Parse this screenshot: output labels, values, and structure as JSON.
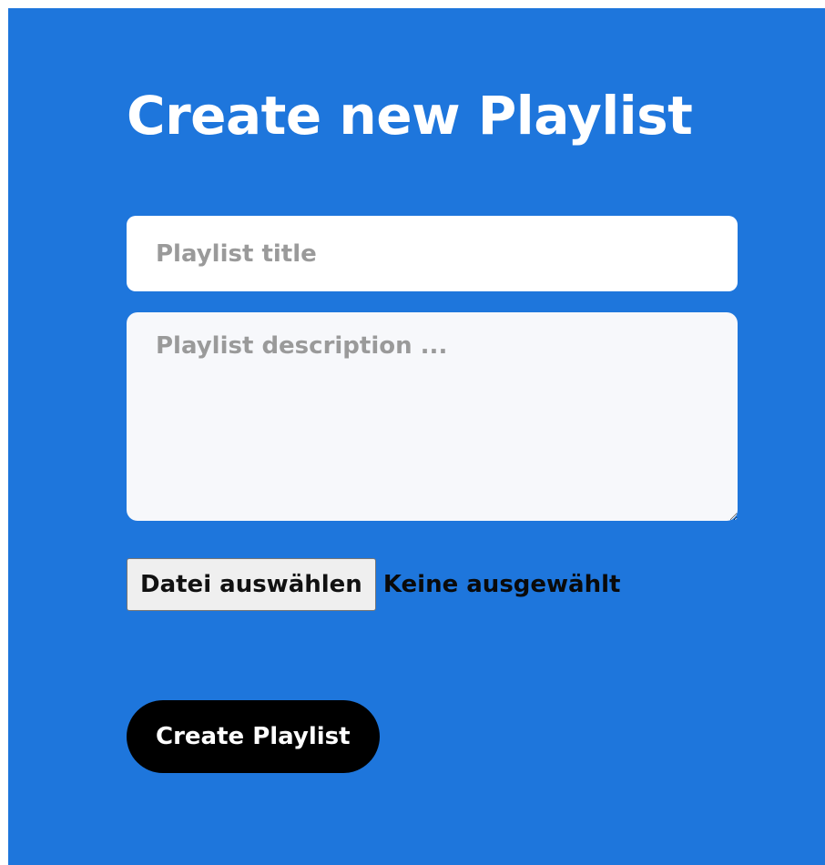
{
  "page": {
    "background_color": "#1e76dc"
  },
  "form": {
    "title": "Create new Playlist",
    "title_field": {
      "placeholder": "Playlist title",
      "value": ""
    },
    "description_field": {
      "placeholder": "Playlist description ...",
      "value": ""
    },
    "file_input": {
      "button_label": "Datei auswählen",
      "status_text": "Keine ausgewählt"
    },
    "submit_button": {
      "label": "Create Playlist",
      "color": "#000000"
    }
  }
}
